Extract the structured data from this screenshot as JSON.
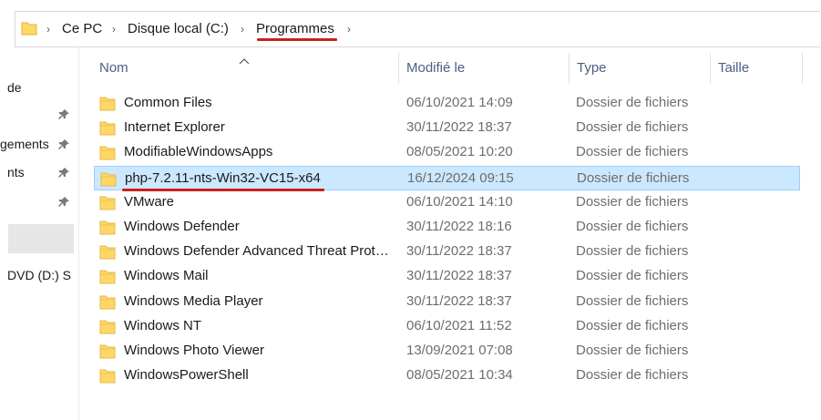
{
  "breadcrumb": {
    "items": [
      {
        "label": "Ce PC"
      },
      {
        "label": "Disque local (C:)"
      },
      {
        "label": "Programmes"
      }
    ]
  },
  "nav_pane": {
    "items": [
      {
        "label": "de",
        "pinned": false
      },
      {
        "label": "",
        "pinned": true
      },
      {
        "label": "gements",
        "pinned": true
      },
      {
        "label": "nts",
        "pinned": true
      },
      {
        "label": "",
        "pinned": true
      },
      {
        "label": "DVD (D:) S",
        "pinned": false
      }
    ]
  },
  "columns": {
    "name": "Nom",
    "modified": "Modifié le",
    "type": "Type",
    "size": "Taille"
  },
  "files": [
    {
      "name": "Common Files",
      "modified": "06/10/2021 14:09",
      "type": "Dossier de fichiers"
    },
    {
      "name": "Internet Explorer",
      "modified": "30/11/2022 18:37",
      "type": "Dossier de fichiers"
    },
    {
      "name": "ModifiableWindowsApps",
      "modified": "08/05/2021 10:20",
      "type": "Dossier de fichiers"
    },
    {
      "name": "php-7.2.11-nts-Win32-VC15-x64",
      "modified": "16/12/2024 09:15",
      "type": "Dossier de fichiers",
      "selected": true
    },
    {
      "name": "VMware",
      "modified": "06/10/2021 14:10",
      "type": "Dossier de fichiers"
    },
    {
      "name": "Windows Defender",
      "modified": "30/11/2022 18:16",
      "type": "Dossier de fichiers"
    },
    {
      "name": "Windows Defender Advanced Threat Prot…",
      "modified": "30/11/2022 18:37",
      "type": "Dossier de fichiers"
    },
    {
      "name": "Windows Mail",
      "modified": "30/11/2022 18:37",
      "type": "Dossier de fichiers"
    },
    {
      "name": "Windows Media Player",
      "modified": "30/11/2022 18:37",
      "type": "Dossier de fichiers"
    },
    {
      "name": "Windows NT",
      "modified": "06/10/2021 11:52",
      "type": "Dossier de fichiers"
    },
    {
      "name": "Windows Photo Viewer",
      "modified": "13/09/2021 07:08",
      "type": "Dossier de fichiers"
    },
    {
      "name": "WindowsPowerShell",
      "modified": "08/05/2021 10:34",
      "type": "Dossier de fichiers"
    }
  ],
  "colors": {
    "selection_bg": "#cce8ff",
    "selection_border": "#99d1ff",
    "folder_yellow": "#ffd766",
    "annotation_red": "#cc1f1f",
    "header_text": "#4a5f82"
  }
}
